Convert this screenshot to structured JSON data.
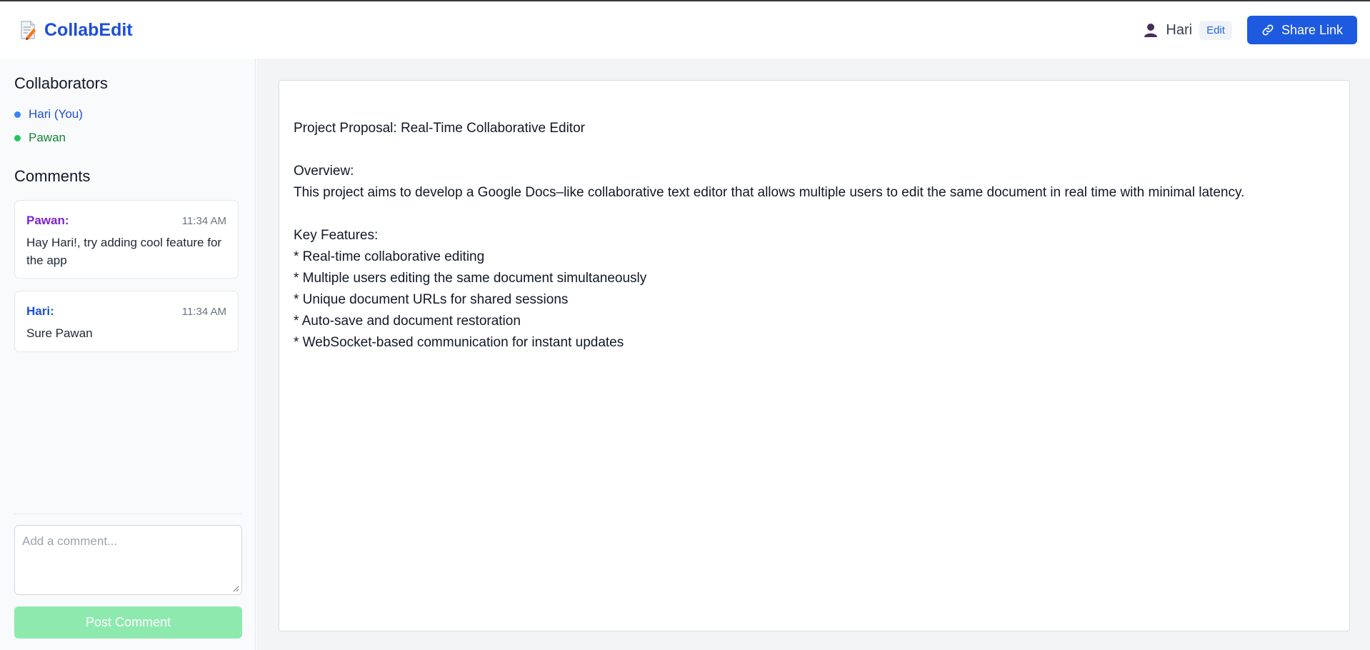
{
  "app": {
    "title": "CollabEdit"
  },
  "header": {
    "user_name": "Hari",
    "role": "Edit",
    "share_label": "Share Link"
  },
  "sidebar": {
    "collaborators_title": "Collaborators",
    "collaborators": [
      {
        "name": "Hari (You)",
        "color": "#3b82f6",
        "text_color": "#1d4ed8"
      },
      {
        "name": "Pawan",
        "color": "#22c55e",
        "text_color": "#15803d"
      }
    ],
    "comments_title": "Comments",
    "comments": [
      {
        "author": "Pawan:",
        "time": "11:34 AM",
        "text": "Hay Hari!, try adding cool feature for the app",
        "author_color": "#7e22ce"
      },
      {
        "author": "Hari:",
        "time": "11:34 AM",
        "text": "Sure Pawan",
        "author_color": "#1d4ed8"
      }
    ],
    "comment_placeholder": "Add a comment...",
    "post_label": "Post Comment"
  },
  "document": {
    "lines": [
      "Project Proposal: Real-Time Collaborative Editor",
      "",
      "Overview:",
      "This project aims to develop a Google Docs–like collaborative text editor that allows multiple users to edit the same document in real time with minimal latency.",
      "",
      "Key Features:",
      "* Real-time collaborative editing",
      "* Multiple users editing the same document simultaneously",
      "* Unique document URLs for shared sessions",
      "* Auto-save and document restoration",
      "* WebSocket-based communication for instant updates"
    ]
  },
  "colors": {
    "brand": "#1d4ed8",
    "share_button": "#1d5ae0",
    "post_button_disabled": "#8ee9ae"
  },
  "icons": {
    "brand": "memo-pencil-icon",
    "user": "user-icon",
    "share": "link-icon"
  }
}
